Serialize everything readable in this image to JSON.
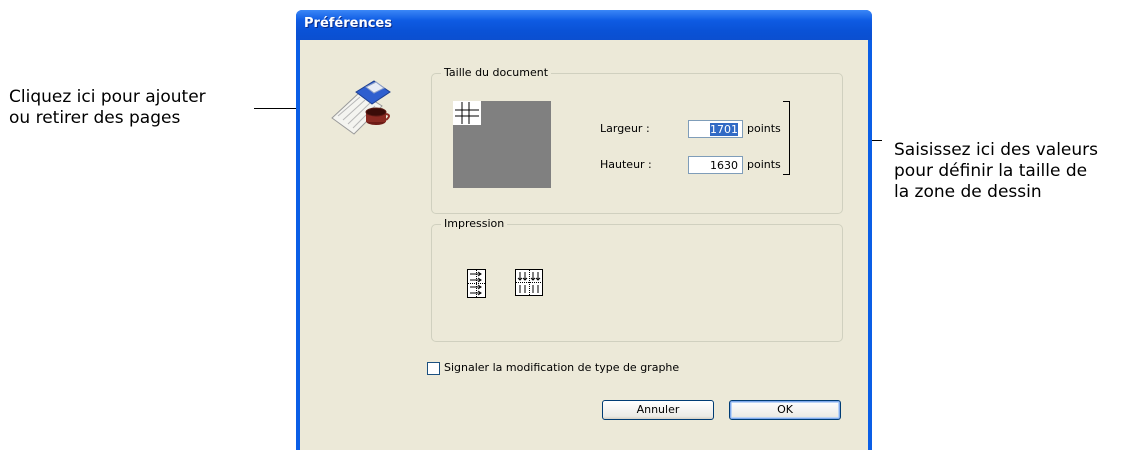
{
  "window": {
    "title": "Préférences"
  },
  "document_size": {
    "legend": "Taille du document",
    "width_label": "Largeur :",
    "width_value": "1701",
    "width_unit": "points",
    "height_label": "Hauteur :",
    "height_value": "1630",
    "height_unit": "points"
  },
  "printing": {
    "legend": "Impression"
  },
  "options": {
    "graph_type_checkbox_label": "Signaler la modification de type de graphe",
    "graph_type_checked": false
  },
  "buttons": {
    "cancel_label": "Annuler",
    "ok_label": "OK"
  },
  "callouts": {
    "left_line1": "Cliquez ici pour ajouter",
    "left_line2": "ou retirer des pages",
    "right_line1": "Saisissez ici des valeurs",
    "right_line2": "pour définir la taille de",
    "right_line3": "la zone de dessin"
  },
  "colors": {
    "titlebar": "#0a5ee6",
    "dialog_face": "#ece9d8",
    "preview": "#808080",
    "selection": "#316ac5"
  }
}
